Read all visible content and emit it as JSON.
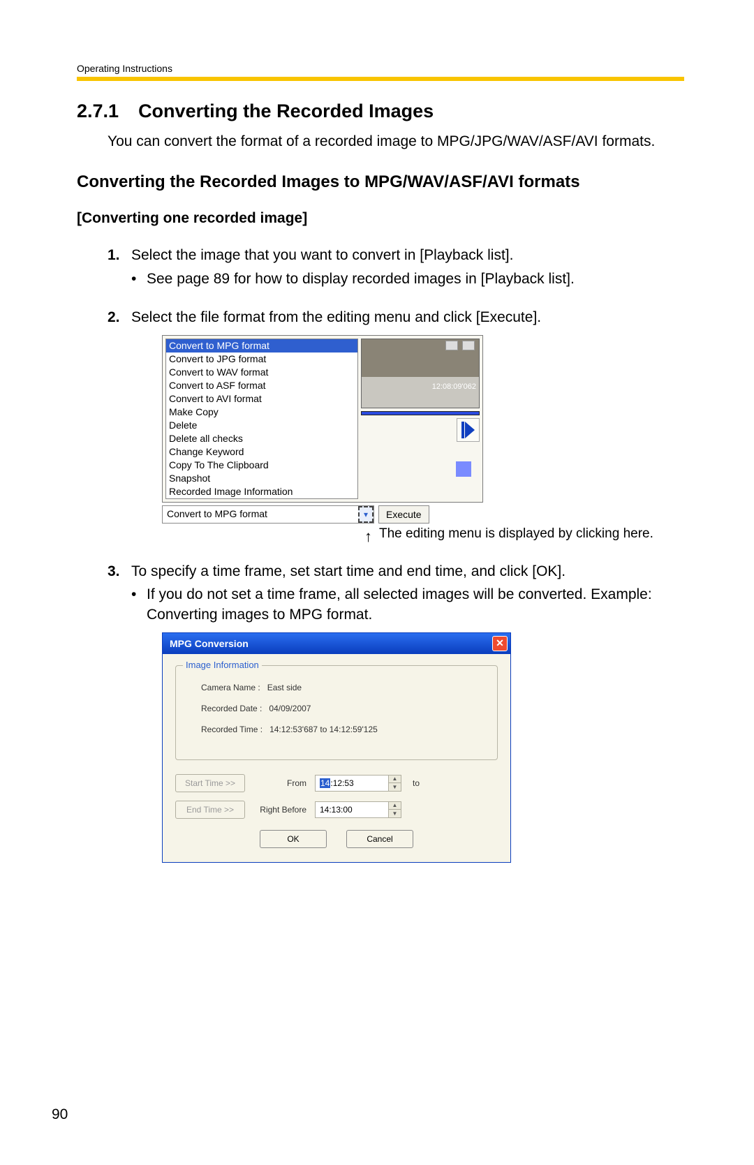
{
  "header": {
    "running": "Operating Instructions"
  },
  "section": {
    "number": "2.7.1",
    "title": "Converting the Recorded Images",
    "intro": "You can convert the format of a recorded image to MPG/JPG/WAV/ASF/AVI formats."
  },
  "sub_heading": "Converting the Recorded Images to MPG/WAV/ASF/AVI formats",
  "bracket_heading": "[Converting one recorded image]",
  "steps": {
    "s1": {
      "num": "1.",
      "text": "Select the image that you want to convert in [Playback list].",
      "bullet": "See page 89 for how to display recorded images in [Playback list]."
    },
    "s2": {
      "num": "2.",
      "text": "Select the file format from the editing menu and click [Execute]."
    },
    "s3": {
      "num": "3.",
      "text": "To specify a time frame, set start time and end time, and click [OK].",
      "bullet": "If you do not set a time frame, all selected images will be converted. Example: Converting images to MPG format."
    }
  },
  "fig1": {
    "menu": [
      "Convert to MPG format",
      "Convert to JPG format",
      "Convert to WAV format",
      "Convert to ASF format",
      "Convert to AVI format",
      "Make Copy",
      "Delete",
      "Delete all checks",
      "Change Keyword",
      "Copy To The Clipboard",
      "Snapshot",
      "Recorded Image Information"
    ],
    "combo_value": "Convert to MPG format",
    "execute": "Execute",
    "overlay": "12:08:09'062",
    "callout": "The editing menu is displayed by clicking here."
  },
  "fig2": {
    "title": "MPG Conversion",
    "fieldset_legend": "Image Information",
    "camera_label": "Camera Name :",
    "camera_value": "East side",
    "date_label": "Recorded Date :",
    "date_value": "04/09/2007",
    "time_label": "Recorded Time :",
    "time_value": "14:12:53'687   to   14:12:59'125",
    "start_btn": "Start Time >>",
    "from_label": "From",
    "from_value_sel": "14",
    "from_value_rest": ":12:53",
    "to_label": "to",
    "end_btn": "End Time >>",
    "before_label": "Right Before",
    "before_value": "14:13:00",
    "ok": "OK",
    "cancel": "Cancel"
  },
  "page_number": "90"
}
